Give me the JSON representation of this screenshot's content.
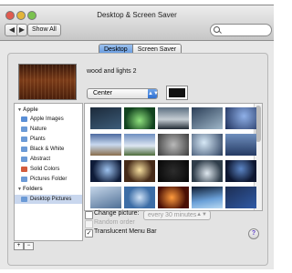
{
  "window": {
    "title": "Desktop & Screen Saver",
    "show_all_label": "Show All",
    "search": {
      "value": "",
      "placeholder": ""
    }
  },
  "tabs": [
    {
      "label": "Desktop",
      "selected": true
    },
    {
      "label": "Screen Saver",
      "selected": false
    }
  ],
  "current": {
    "wallpaper_name": "wood and lights 2",
    "position": "Center",
    "swatch_color": "#111111"
  },
  "sidebar": {
    "sections": [
      {
        "label": "Apple",
        "expanded": true
      },
      {
        "label": "Folders",
        "expanded": true
      }
    ],
    "items": [
      {
        "label": "Apple Images",
        "icon": "apple-images-icon",
        "color": "#5a8fd6"
      },
      {
        "label": "Nature",
        "icon": "folder-icon",
        "color": "#6b9ad6"
      },
      {
        "label": "Plants",
        "icon": "folder-icon",
        "color": "#6b9ad6"
      },
      {
        "label": "Black & White",
        "icon": "folder-icon",
        "color": "#6b9ad6"
      },
      {
        "label": "Abstract",
        "icon": "folder-icon",
        "color": "#6b9ad6"
      },
      {
        "label": "Solid Colors",
        "icon": "color-swatch-icon",
        "color": "#d25b3d"
      },
      {
        "label": "Pictures Folder",
        "icon": "folder-icon",
        "color": "#6b9ad6"
      },
      {
        "label": "Desktop Pictures",
        "icon": "folder-icon",
        "color": "#6b9ad6",
        "selected": true
      }
    ],
    "add_label": "+",
    "remove_label": "−"
  },
  "thumbnails": [
    "linear-gradient(160deg,#1c2a3a,#3d5d7a)",
    "radial-gradient(circle at 50% 60%,#8fe27d,#12431f 70%)",
    "linear-gradient(180deg,#5b6e80,#c5cdd3 55%,#202a33)",
    "linear-gradient(150deg,#2b3e57,#9fb7c9)",
    "radial-gradient(circle at 60% 40%,#8fb0e8,#1d2f5a)",
    "linear-gradient(180deg,#4d6aa0,#c9d9ef 50%,#8a6f4c)",
    "linear-gradient(180deg,#6e8fc0,#dde6f2 55%,#4e6b3a)",
    "radial-gradient(circle at 50% 50%,#b9b9b9,#3d3d3d)",
    "radial-gradient(circle at 40% 40%,#d6e8f6,#2b3f5e)",
    "linear-gradient(180deg,#6f8fbe,#253a63)",
    "radial-gradient(circle at 55% 45%,#9ec3f0,#0e1b38 70%)",
    "radial-gradient(circle at 50% 45%,#f7e0a0,#452a18 65%)",
    "radial-gradient(circle at 50% 50%,#2c2c2c,#050505)",
    "radial-gradient(circle at 50% 60%,#dfe8ef,#2f3d4a 70%)",
    "radial-gradient(circle at 50% 40%,#5c86c6,#0d1630 70%)",
    "linear-gradient(160deg,#c6d7ea,#4f6f95)",
    "radial-gradient(circle at 50% 50%,#cfe2f7,#3c6da6 60%)",
    "radial-gradient(circle at 45% 50%,#ff9b3d,#4a1005 70%)",
    "linear-gradient(170deg,#0d1a2f,#6aa0d8 60%,#b7d8f2)",
    "linear-gradient(150deg,#1d2e53,#2f5aa6)"
  ],
  "options": {
    "change_picture_label": "Change picture:",
    "change_picture_checked": false,
    "interval": "every 30 minutes",
    "random_order_label": "Random order",
    "random_order_checked": false,
    "translucent_label": "Translucent Menu Bar",
    "translucent_checked": true
  },
  "help_label": "?",
  "scroll_arrows": "▲▼",
  "check_mark": "✓"
}
